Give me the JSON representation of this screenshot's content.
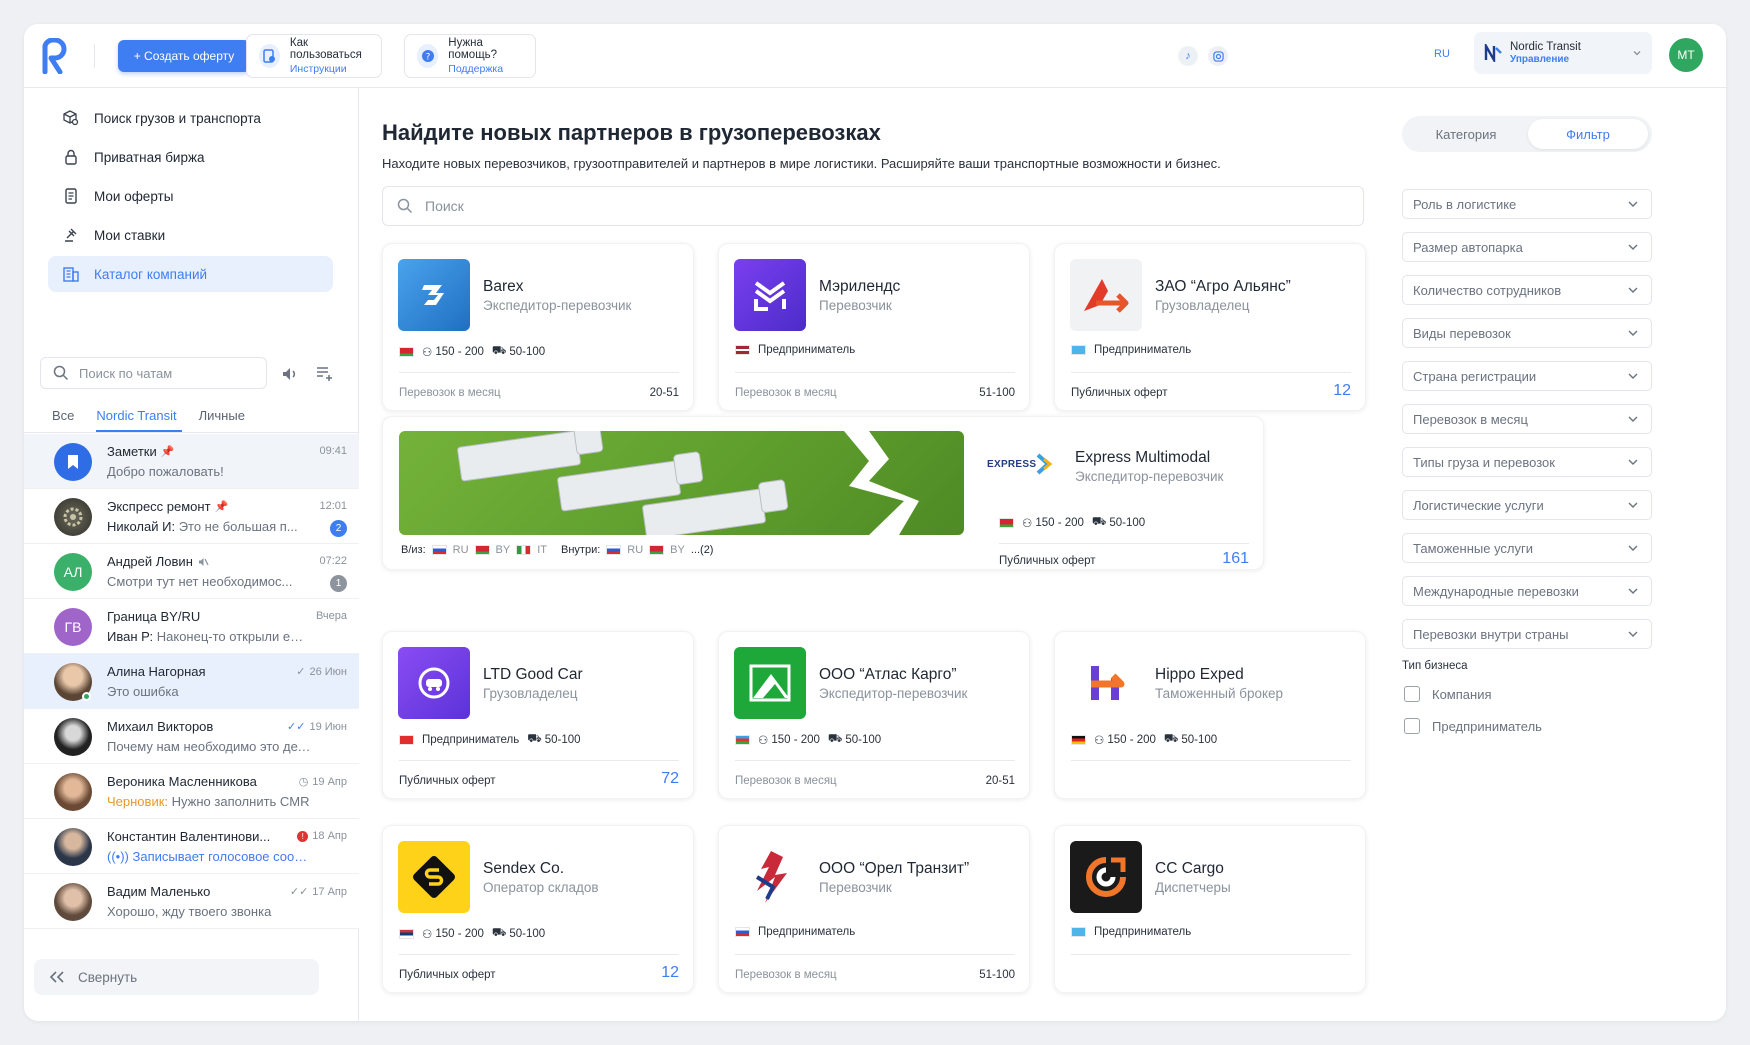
{
  "header": {
    "create_button": "+ Создать оферту",
    "help1": {
      "title": "Как пользоваться",
      "link": "Инструкции"
    },
    "help2": {
      "title": "Нужна помощь?",
      "link": "Поддержка"
    },
    "lang": "RU",
    "company": {
      "name": "Nordic Transit",
      "sub": "Управление"
    },
    "avatar": "MT"
  },
  "sidebar": {
    "nav": [
      {
        "label": "Поиск грузов и транспорта",
        "icon": "box-search-icon"
      },
      {
        "label": "Приватная биржа",
        "icon": "lock-icon"
      },
      {
        "label": "Мои оферты",
        "icon": "document-icon"
      },
      {
        "label": "Мои ставки",
        "icon": "gavel-icon"
      },
      {
        "label": "Каталог компаний",
        "icon": "building-icon"
      }
    ],
    "chat_search_placeholder": "Поиск по чатам",
    "tabs": [
      "Все",
      "Nordic Transit",
      "Личные"
    ],
    "chats": [
      {
        "name": "Заметки",
        "time": "09:41",
        "preview": "Добро пожаловать!",
        "avatar": "",
        "pinned": true
      },
      {
        "name": "Экспресс ремонт",
        "time": "12:01",
        "sender": "Николай И:",
        "preview": " Это не большая п...",
        "badge": "2",
        "pinned": true
      },
      {
        "name": "Андрей Ловин",
        "time": "07:22",
        "preview": "Смотри тут нет необходимос...",
        "avatar": "АЛ",
        "badge": "1",
        "muted": true
      },
      {
        "name": "Граница BY/RU",
        "time": "Вчера",
        "sender": "Иван Р:",
        "preview": " Наконец-то открыли еще ...",
        "avatar": "ГВ"
      },
      {
        "name": "Алина Нагорная",
        "time": "26 Июн",
        "preview": "Это ошибка"
      },
      {
        "name": "Михаил Викторов",
        "time": "19 Июн",
        "preview": "Почему нам необходимо это делать"
      },
      {
        "name": "Вероника Масленникова",
        "time": "19 Апр",
        "draft": "Черновик:",
        "preview": " Нужно заполнить CMR"
      },
      {
        "name": "Константин Валентинови...",
        "time": "18 Апр",
        "preview": "Записывает голосовое сообще..."
      },
      {
        "name": "Вадим Маленько",
        "time": "17 Апр",
        "preview": "Хорошо, жду твоего звонка"
      }
    ],
    "collapse": "Свернуть"
  },
  "main": {
    "title": "Найдите новых партнеров в грузоперевозках",
    "subtitle": "Находите новых перевозчиков, грузоотправителей и партнеров в мире логистики. Расширяйте ваши транспортные возможности и бизнес.",
    "search_placeholder": "Поиск",
    "cards": [
      {
        "name": "Barex",
        "role": "Экспедитор-перевозчик",
        "employees": "150 - 200",
        "fleet": "50-100",
        "foot_label": "Перевозок в месяц",
        "foot_value": "20-51"
      },
      {
        "name": "Мэрилендс",
        "role": "Перевозчик",
        "tag": "Предприниматель",
        "foot_label": "Перевозок в месяц",
        "foot_value": "51-100"
      },
      {
        "name": "ЗАО “Агро Альянс”",
        "role": "Грузовладелец",
        "tag": "Предприниматель",
        "foot_label": "Публичных оферт",
        "foot_value": "12"
      },
      {
        "name": "LTD Good Car",
        "role": "Грузовладелец",
        "tag": "Предприниматель",
        "fleet": "50-100",
        "foot_label": "Публичных оферт",
        "foot_value": "72"
      },
      {
        "name": "ООО “Атлас Карго”",
        "role": "Экспедитор-перевозчик",
        "employees": "150 - 200",
        "fleet": "50-100",
        "foot_label": "Перевозок в месяц",
        "foot_value": "20-51"
      },
      {
        "name": "Hippo Exped",
        "role": "Таможенный брокер",
        "employees": "150 - 200",
        "fleet": "50-100"
      },
      {
        "name": "Sendex Co.",
        "role": "Оператор складов",
        "employees": "150 - 200",
        "fleet": "50-100",
        "foot_label": "Публичных оферт",
        "foot_value": "12"
      },
      {
        "name": "ООО “Орел Транзит”",
        "role": "Перевозчик",
        "tag": "Предприниматель",
        "foot_label": "Перевозок в месяц",
        "foot_value": "51-100"
      },
      {
        "name": "CC Cargo",
        "role": "Диспетчеры",
        "tag": "Предприниматель"
      }
    ],
    "featured": {
      "name": "Express Multimodal",
      "role": "Экспедитор-перевозчик",
      "logo_text": "EXPRESS",
      "employees": "150 - 200",
      "fleet": "50-100",
      "foot_label": "Публичных оферт",
      "foot_value": "161",
      "route_from_label": "В/из:",
      "route_from": [
        "RU",
        "BY",
        "IT"
      ],
      "route_in_label": "Внутри:",
      "route_in": [
        "RU",
        "BY"
      ],
      "route_more": "...(2)"
    }
  },
  "filters": {
    "segments": [
      "Категория",
      "Фильтр"
    ],
    "dropdowns": [
      "Роль в логистике",
      "Размер автопарка",
      "Количество сотрудников",
      "Виды перевозок",
      "Страна регистрации",
      "Перевозок в месяц",
      "Типы груза и перевозок",
      "Логистические услуги",
      "Таможенные услуги",
      "Международные перевозки",
      "Перевозки внутри страны"
    ],
    "business_type_title": "Тип бизнеса",
    "business_types": [
      "Компания",
      "Предприниматель"
    ]
  },
  "colors": {
    "accent": "#3f7df2",
    "success": "#2fa760"
  }
}
